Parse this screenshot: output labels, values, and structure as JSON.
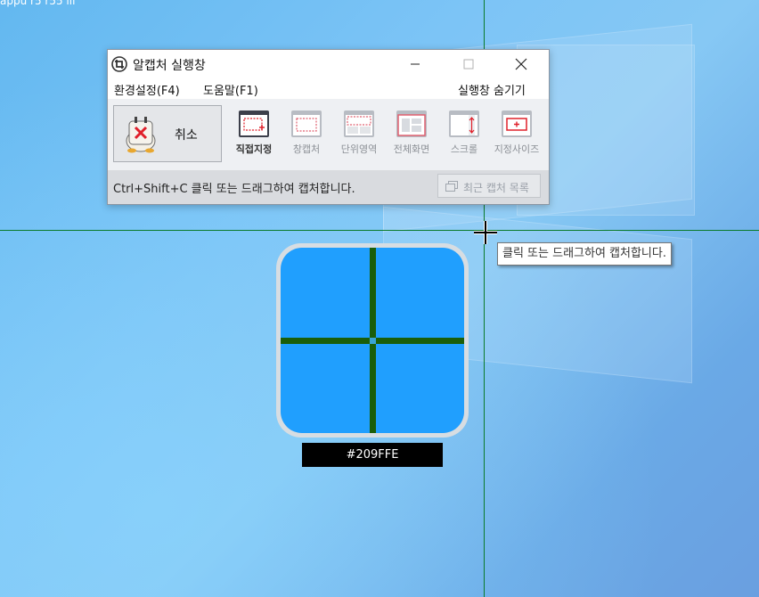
{
  "desktop": {
    "top_label": "appu r5 r55 lii"
  },
  "window": {
    "title": "알캡처 실행창",
    "menu": {
      "settings": "환경설정(F4)",
      "help": "도움말(F1)",
      "hide": "실행창 숨기기"
    },
    "cancel_label": "취소",
    "tools": [
      {
        "label": "직접지정",
        "icon": "direct-select-icon",
        "active": true
      },
      {
        "label": "창캡처",
        "icon": "window-capture-icon",
        "active": false
      },
      {
        "label": "단위영역",
        "icon": "unit-area-icon",
        "active": false
      },
      {
        "label": "전체화면",
        "icon": "full-screen-icon",
        "active": false
      },
      {
        "label": "스크롤",
        "icon": "scroll-icon",
        "active": false
      },
      {
        "label": "지정사이즈",
        "icon": "fixed-size-icon",
        "active": false
      }
    ],
    "status_text": "Ctrl+Shift+C 클릭 또는 드래그하여 캡처합니다.",
    "recent_label": "최근 캡처 목록"
  },
  "tooltip": "클릭 또는 드래그하여 캡처합니다.",
  "magnifier": {
    "color_code": "#209FFE",
    "color": "#209ffe"
  }
}
